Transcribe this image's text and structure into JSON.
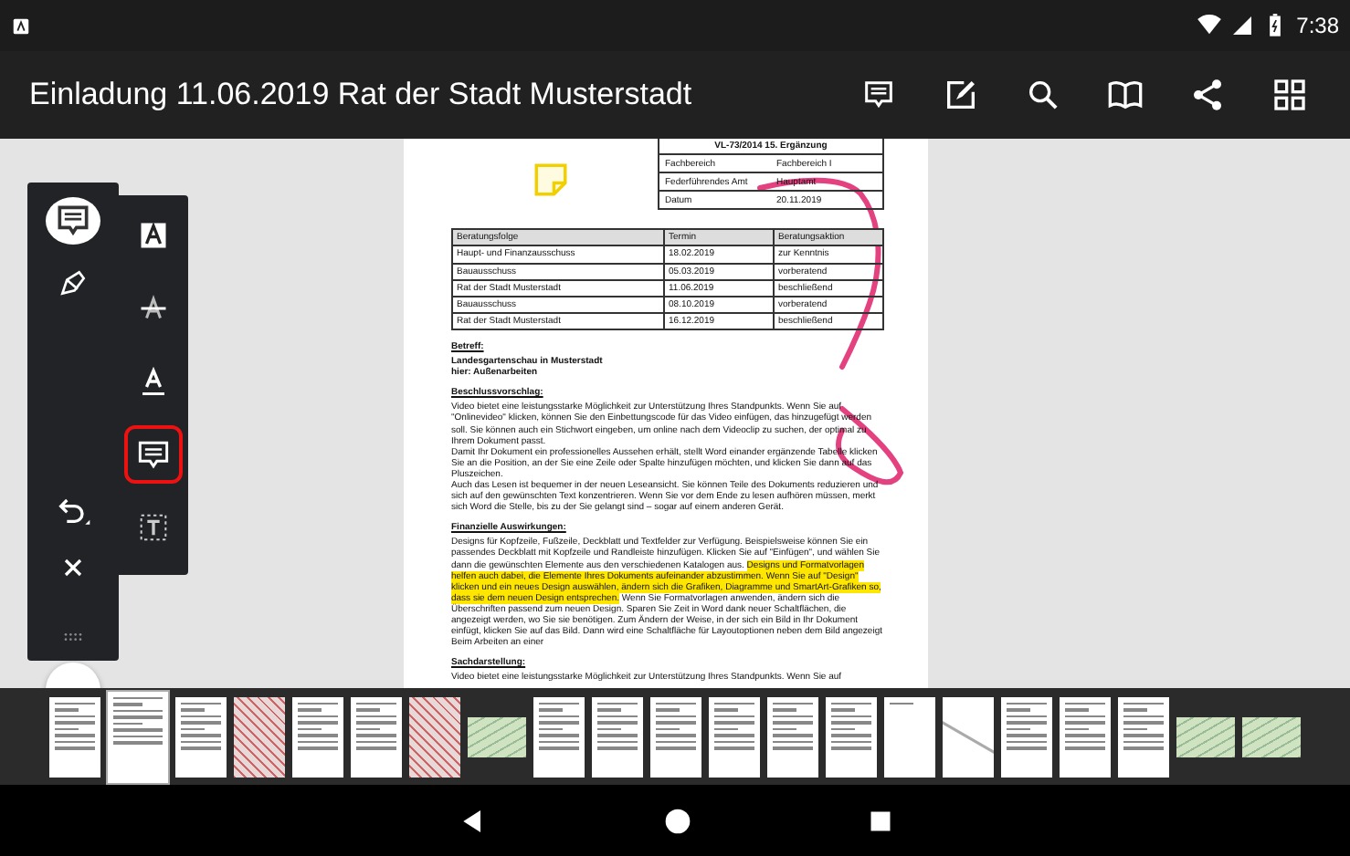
{
  "status_bar": {
    "time": "7:38"
  },
  "app_bar": {
    "title": "Einladung 11.06.2019 Rat der Stadt Musterstadt"
  },
  "mode_tools": [
    {
      "kind": "comment",
      "selected": true
    },
    {
      "kind": "pen",
      "selected": false
    },
    {
      "kind": "undo",
      "selected": false
    },
    {
      "kind": "close",
      "selected": false
    },
    {
      "kind": "handle",
      "selected": false
    }
  ],
  "annotation_tools": [
    {
      "kind": "highlight",
      "selected": false
    },
    {
      "kind": "strikethrough",
      "selected": false
    },
    {
      "kind": "underline",
      "selected": false
    },
    {
      "kind": "note",
      "selected": true
    },
    {
      "kind": "textbox",
      "selected": false
    }
  ],
  "document": {
    "header_box": {
      "title": "VL-73/2014 15. Ergänzung",
      "rows": [
        {
          "label": "Fachbereich",
          "value": "Fachbereich I"
        },
        {
          "label": "Federführendes Amt",
          "value": "Hauptamt"
        },
        {
          "label": "Datum",
          "value": "20.11.2019"
        }
      ]
    },
    "consultation_table": {
      "columns": [
        "Beratungsfolge",
        "Termin",
        "Beratungsaktion"
      ],
      "rows": [
        [
          "Haupt- und Finanzausschuss",
          "18.02.2019",
          "zur Kenntnis"
        ],
        [
          "Bauausschuss",
          "05.03.2019",
          "vorberatend"
        ],
        [
          "Rat der Stadt Musterstadt",
          "11.06.2019",
          "beschließend"
        ],
        [
          "Bauausschuss",
          "08.10.2019",
          "vorberatend"
        ],
        [
          "Rat der Stadt Musterstadt",
          "16.12.2019",
          "beschließend"
        ]
      ]
    },
    "sections": [
      {
        "heading": "Betreff:",
        "paragraphs": [
          {
            "bold": true,
            "segments": [
              {
                "text": "Landesgartenschau in Musterstadt",
                "highlighted": false
              }
            ]
          },
          {
            "bold": true,
            "segments": [
              {
                "text": "hier: Außenarbeiten",
                "highlighted": false
              }
            ]
          }
        ]
      },
      {
        "heading": "Beschlussvorschlag:",
        "paragraphs": [
          {
            "bold": false,
            "segments": [
              {
                "text": "Video bietet eine leistungsstarke Möglichkeit zur Unterstützung Ihres Standpunkts. Wenn Sie auf \"Onlinevideo\" klicken, können Sie den Einbettungscode für das Video einfügen, das hinzugefügt werden soll. Sie können auch ein Stichwort eingeben, um online nach dem Videoclip zu suchen, der optimal zu Ihrem Dokument passt.",
                "highlighted": false
              }
            ]
          },
          {
            "bold": false,
            "segments": [
              {
                "text": "Damit Ihr Dokument ein professionelles Aussehen erhält, stellt Word einander ergänzende Tabelle klicken Sie an die Position, an der Sie eine Zeile oder Spalte hinzufügen möchten, und klicken Sie dann auf das Pluszeichen.",
                "highlighted": false
              }
            ]
          },
          {
            "bold": false,
            "segments": [
              {
                "text": "Auch das Lesen ist bequemer in der neuen Leseansicht. Sie können Teile des Dokuments reduzieren und sich auf den gewünschten Text konzentrieren. Wenn Sie vor dem Ende zu lesen aufhören müssen, merkt sich Word die Stelle, bis zu der Sie gelangt sind – sogar auf einem anderen Gerät.",
                "highlighted": false
              }
            ]
          }
        ]
      },
      {
        "heading": "Finanzielle Auswirkungen:",
        "paragraphs": [
          {
            "bold": false,
            "segments": [
              {
                "text": "Designs für Kopfzeile, Fußzeile, Deckblatt und Textfelder zur Verfügung. Beispielsweise können Sie ein passendes Deckblatt mit Kopfzeile und Randleiste hinzufügen. Klicken Sie auf \"Einfügen\", und wählen Sie dann die gewünschten Elemente aus den verschiedenen Katalogen aus. ",
                "highlighted": false
              },
              {
                "text": "Designs und Formatvorlagen helfen auch dabei, die Elemente Ihres Dokuments aufeinander abzustimmen. Wenn Sie auf \"Design\" klicken und ein neues Design auswählen, ändern sich die Grafiken, Diagramme und SmartArt-Grafiken so, dass sie dem neuen Design entsprechen.",
                "highlighted": true
              },
              {
                "text": " Wenn Sie Formatvorlagen anwenden, ändern sich die Überschriften passend zum neuen Design. Sparen Sie Zeit in Word dank neuer Schaltflächen, die angezeigt werden, wo Sie sie benötigen. Zum Ändern der Weise, in der sich ein Bild in Ihr Dokument einfügt, klicken Sie auf das Bild. Dann wird eine Schaltfläche für Layoutoptionen neben dem Bild angezeigt Beim Arbeiten an einer",
                "highlighted": false
              }
            ]
          }
        ]
      },
      {
        "heading": "Sachdarstellung:",
        "paragraphs": [
          {
            "bold": false,
            "segments": [
              {
                "text": "Video bietet eine leistungsstarke Möglichkeit zur Unterstützung Ihres Standpunkts. Wenn Sie auf",
                "highlighted": false
              }
            ]
          }
        ]
      }
    ]
  },
  "thumbnails": [
    {
      "kind": "text",
      "selected": false
    },
    {
      "kind": "text",
      "selected": true
    },
    {
      "kind": "text",
      "selected": false
    },
    {
      "kind": "map",
      "selected": false
    },
    {
      "kind": "text",
      "selected": false
    },
    {
      "kind": "text",
      "selected": false
    },
    {
      "kind": "map",
      "selected": false
    },
    {
      "kind": "landscape",
      "selected": false
    },
    {
      "kind": "text",
      "selected": false
    },
    {
      "kind": "text",
      "selected": false
    },
    {
      "kind": "text",
      "selected": false
    },
    {
      "kind": "text",
      "selected": false
    },
    {
      "kind": "text",
      "selected": false
    },
    {
      "kind": "text",
      "selected": false
    },
    {
      "kind": "blank",
      "selected": false
    },
    {
      "kind": "sketch",
      "selected": false
    },
    {
      "kind": "text",
      "selected": false
    },
    {
      "kind": "text",
      "selected": false
    },
    {
      "kind": "text",
      "selected": false
    },
    {
      "kind": "landscape",
      "selected": false
    },
    {
      "kind": "landscape",
      "selected": false
    }
  ]
}
